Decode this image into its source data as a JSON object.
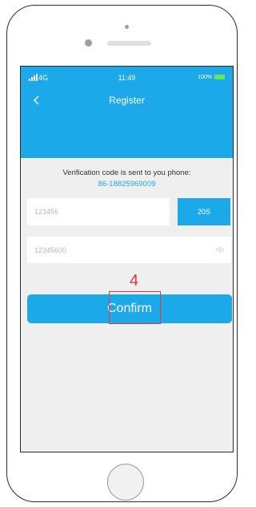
{
  "status_bar": {
    "network": "4G",
    "time": "11:49",
    "battery_percent": "100%",
    "battery_color": "#6ee55a"
  },
  "nav": {
    "title": "Register",
    "back_icon": "chevron-left-icon"
  },
  "verification": {
    "message": "Verification code is sent to you phone:",
    "phone": "86-18825969009"
  },
  "code_field": {
    "value": "123456"
  },
  "timer_button": {
    "label": "20S"
  },
  "password_field": {
    "value": "12345600",
    "icon": "eye-icon"
  },
  "annotation": {
    "step": "4",
    "color": "#e53935"
  },
  "confirm_button": {
    "label": "Confirm"
  },
  "colors": {
    "accent": "#1ba9ea",
    "screen_background": "#efefef"
  }
}
